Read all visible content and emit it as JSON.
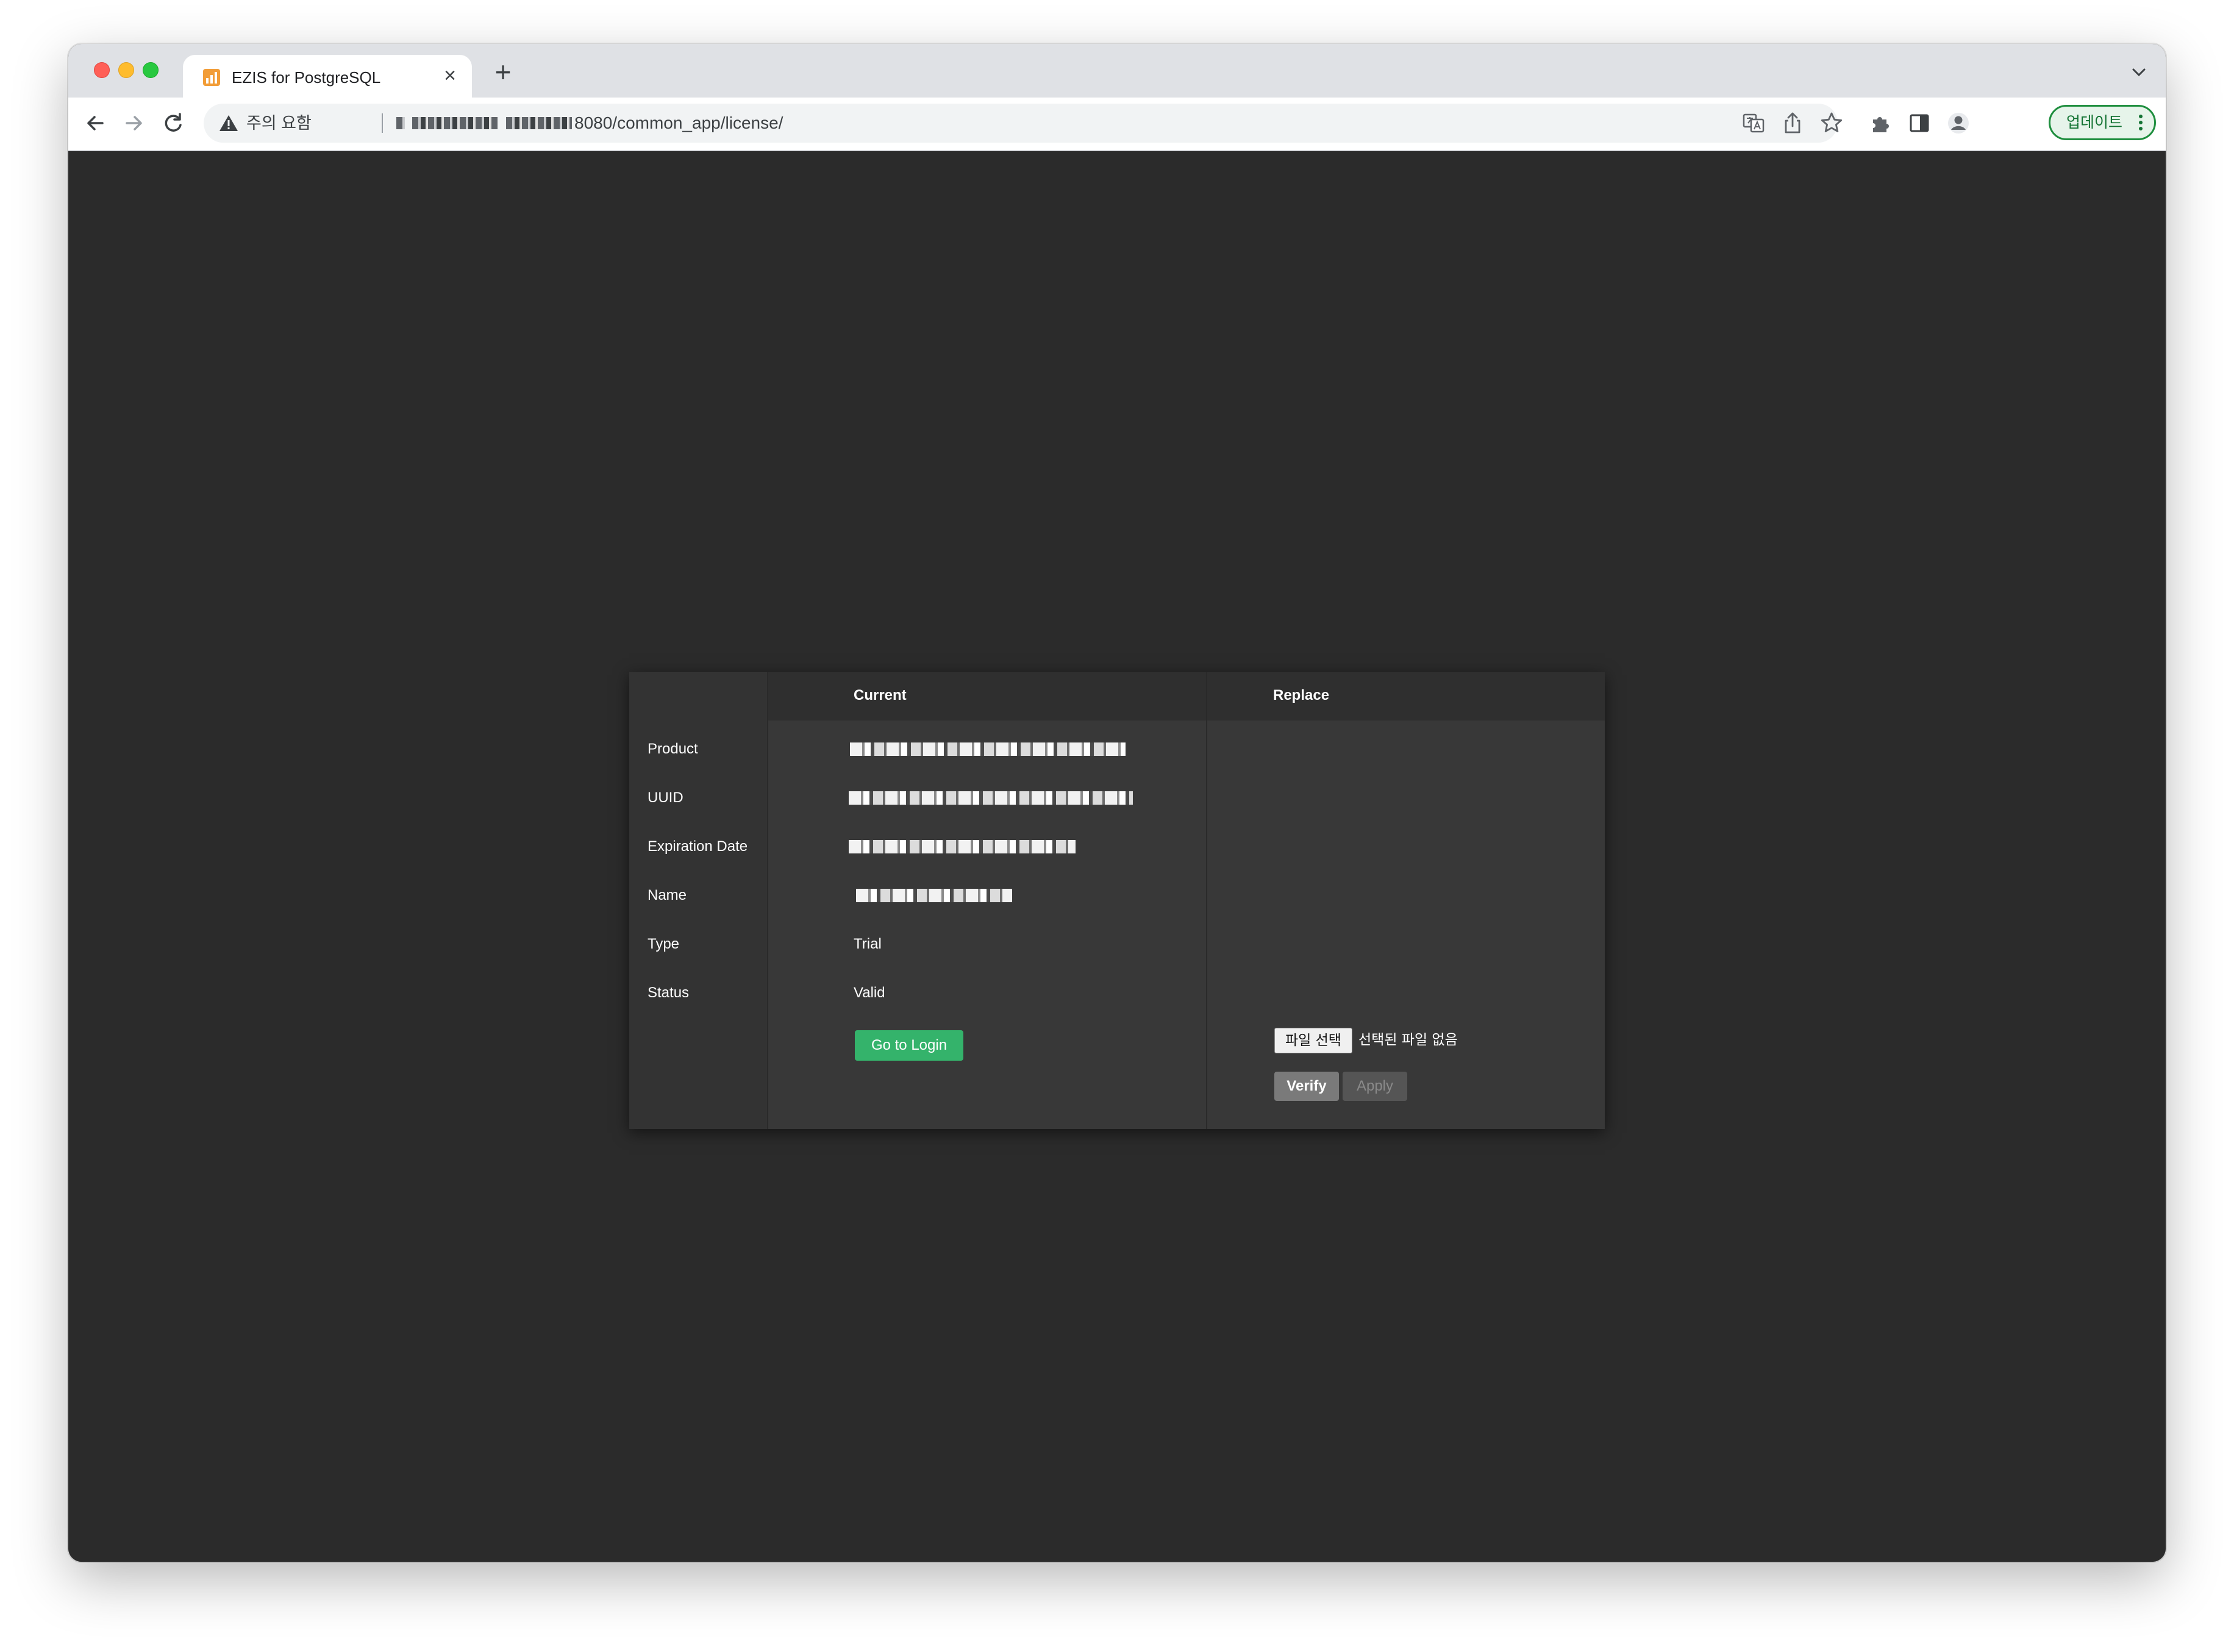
{
  "browser": {
    "tab_title": "EZIS for PostgreSQL",
    "tab_close_glyph": "×",
    "new_tab_glyph": "+",
    "security_warning": "주의 요함",
    "url_visible": "8080/common_app/license/",
    "update_label": "업데이트",
    "icons": [
      "back-arrow-icon",
      "forward-arrow-icon",
      "reload-icon",
      "warning-triangle-icon",
      "translate-icon",
      "share-icon",
      "bookmark-star-icon",
      "extensions-puzzle-icon",
      "side-panel-icon",
      "profile-avatar-icon",
      "kebab-menu-icon",
      "tab-search-chevron-icon"
    ]
  },
  "license": {
    "header_current": "Current",
    "header_replace": "Replace",
    "rows": [
      {
        "label": "Product",
        "value": ""
      },
      {
        "label": "UUID",
        "value": ""
      },
      {
        "label": "Expiration Date",
        "value": ""
      },
      {
        "label": "Name",
        "value": ""
      },
      {
        "label": "Type",
        "value": "Trial"
      },
      {
        "label": "Status",
        "value": "Valid"
      }
    ],
    "go_to_login": "Go to Login",
    "file_choose": "파일 선택",
    "file_none": "선택된 파일 없음",
    "verify": "Verify",
    "apply": "Apply"
  },
  "colors": {
    "page_background": "#2b2b2b",
    "panel_background": "#383838",
    "primary_button": "#34b36b",
    "update_accent": "#1e8e3e"
  }
}
